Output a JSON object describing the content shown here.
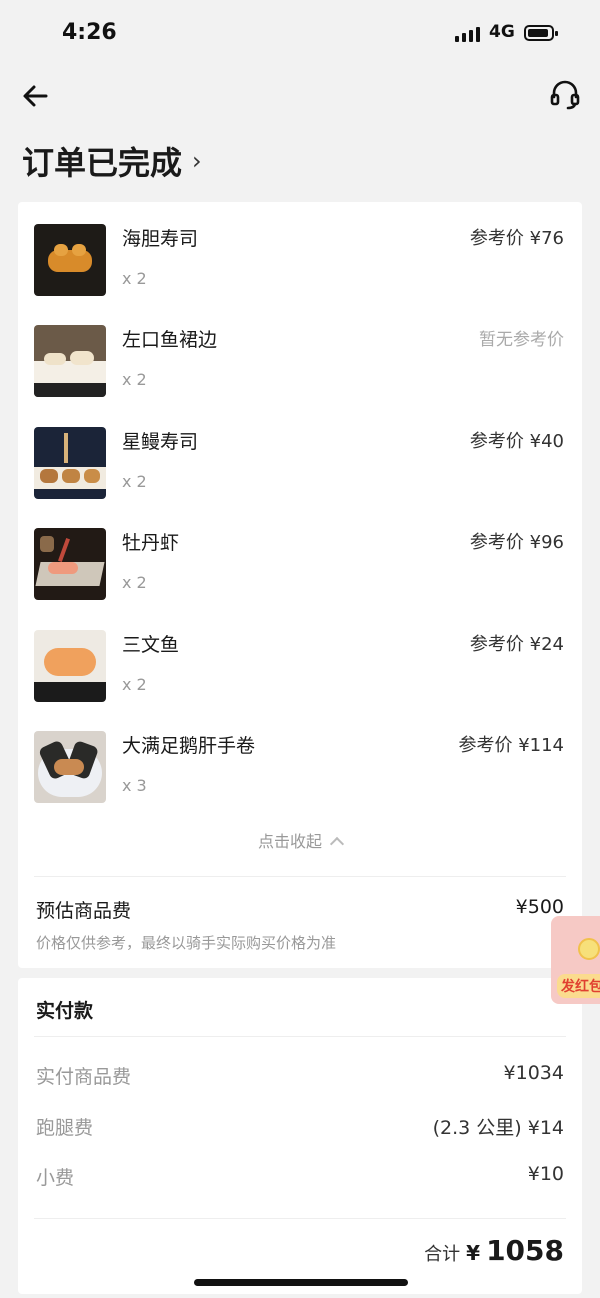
{
  "status_bar": {
    "time": "4:26",
    "network": "4G"
  },
  "header": {
    "title": "订单已完成",
    "title_chevron": "›"
  },
  "items": [
    {
      "name": "海胆寿司",
      "qty": "x 2",
      "price": "参考价 ¥76",
      "thumb": "uni-sushi-photo"
    },
    {
      "name": "左口鱼裙边",
      "qty": "x 2",
      "price": "暂无参考价",
      "thumb": "flounder-fin-photo"
    },
    {
      "name": "星鳗寿司",
      "qty": "x 2",
      "price": "参考价 ¥40",
      "thumb": "eel-sushi-photo"
    },
    {
      "name": "牡丹虾",
      "qty": "x 2",
      "price": "参考价 ¥96",
      "thumb": "botan-shrimp-photo"
    },
    {
      "name": "三文鱼",
      "qty": "x 2",
      "price": "参考价 ¥24",
      "thumb": "salmon-sushi-photo"
    },
    {
      "name": "大满足鹅肝手卷",
      "qty": "x 3",
      "price": "参考价 ¥114",
      "thumb": "foie-gras-handroll-photo"
    }
  ],
  "collapse_label": "点击收起",
  "estimate": {
    "label": "预估商品费",
    "value": "¥500",
    "note": "价格仅供参考，最终以骑手实际购买价格为准"
  },
  "payment": {
    "title": "实付款",
    "rows": [
      {
        "label": "实付商品费",
        "value": "¥1034"
      },
      {
        "label": "跑腿费",
        "value": "(2.3 公里) ¥14"
      },
      {
        "label": "小费",
        "value": "¥10"
      }
    ],
    "total_label": "合计",
    "total_currency": "¥",
    "total_value": "1058"
  },
  "float_badge": {
    "label": "发红包"
  },
  "colors": {
    "background": "#f2f2f2",
    "card": "#ffffff",
    "muted_text": "#999999",
    "badge": "#f6c9c5"
  }
}
